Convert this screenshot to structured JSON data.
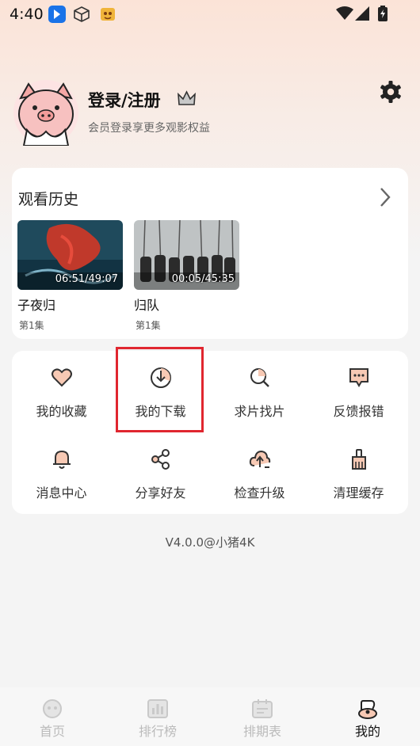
{
  "status_bar": {
    "time": "4:40"
  },
  "profile": {
    "title": "登录/注册",
    "subtitle": "会员登录享更多观影权益"
  },
  "history": {
    "title": "观看历史",
    "items": [
      {
        "title": "子夜归",
        "episode": "第1集",
        "duration": "06:51/49:07"
      },
      {
        "title": "归队",
        "episode": "第1集",
        "duration": "00:05/45:35"
      }
    ]
  },
  "menu": {
    "items": [
      {
        "label": "我的收藏",
        "icon": "heart-icon"
      },
      {
        "label": "我的下载",
        "icon": "download-icon"
      },
      {
        "label": "求片找片",
        "icon": "search-icon"
      },
      {
        "label": "反馈报错",
        "icon": "feedback-icon"
      },
      {
        "label": "消息中心",
        "icon": "bell-icon"
      },
      {
        "label": "分享好友",
        "icon": "share-icon"
      },
      {
        "label": "检查升级",
        "icon": "upgrade-icon"
      },
      {
        "label": "清理缓存",
        "icon": "broom-icon"
      }
    ]
  },
  "version": "V4.0.0@小猪4K",
  "nav": {
    "items": [
      {
        "label": "首页",
        "icon": "home-icon"
      },
      {
        "label": "排行榜",
        "icon": "ranking-icon"
      },
      {
        "label": "排期表",
        "icon": "calendar-icon"
      },
      {
        "label": "我的",
        "icon": "profile-icon"
      }
    ],
    "active_index": 3
  },
  "colors": {
    "accent": "#e0262f",
    "icon_fill": "#f7c9b4",
    "icon_stroke": "#333333"
  }
}
